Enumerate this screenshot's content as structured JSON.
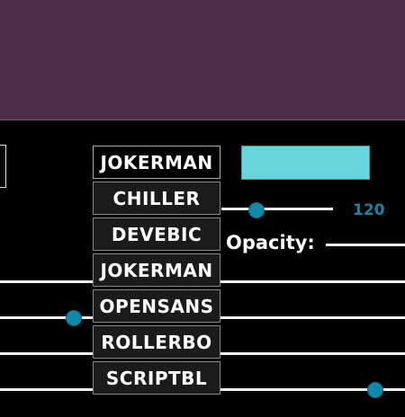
{
  "header": {
    "color": "#4d2d4a"
  },
  "font_dropdown": {
    "selected": "JOKERMAN",
    "options": [
      "CHILLER",
      "DEVEBIC",
      "JOKERMAN",
      "OPENSANS",
      "ROLLERBO",
      "SCRIPTBL"
    ]
  },
  "color_swatch": {
    "color": "#66d6da"
  },
  "size_slider": {
    "value": "120"
  },
  "opacity": {
    "label": "Opacity:"
  },
  "colors": {
    "accent": "#0f8aa8",
    "track": "#f0f0f0",
    "background": "#000000"
  }
}
